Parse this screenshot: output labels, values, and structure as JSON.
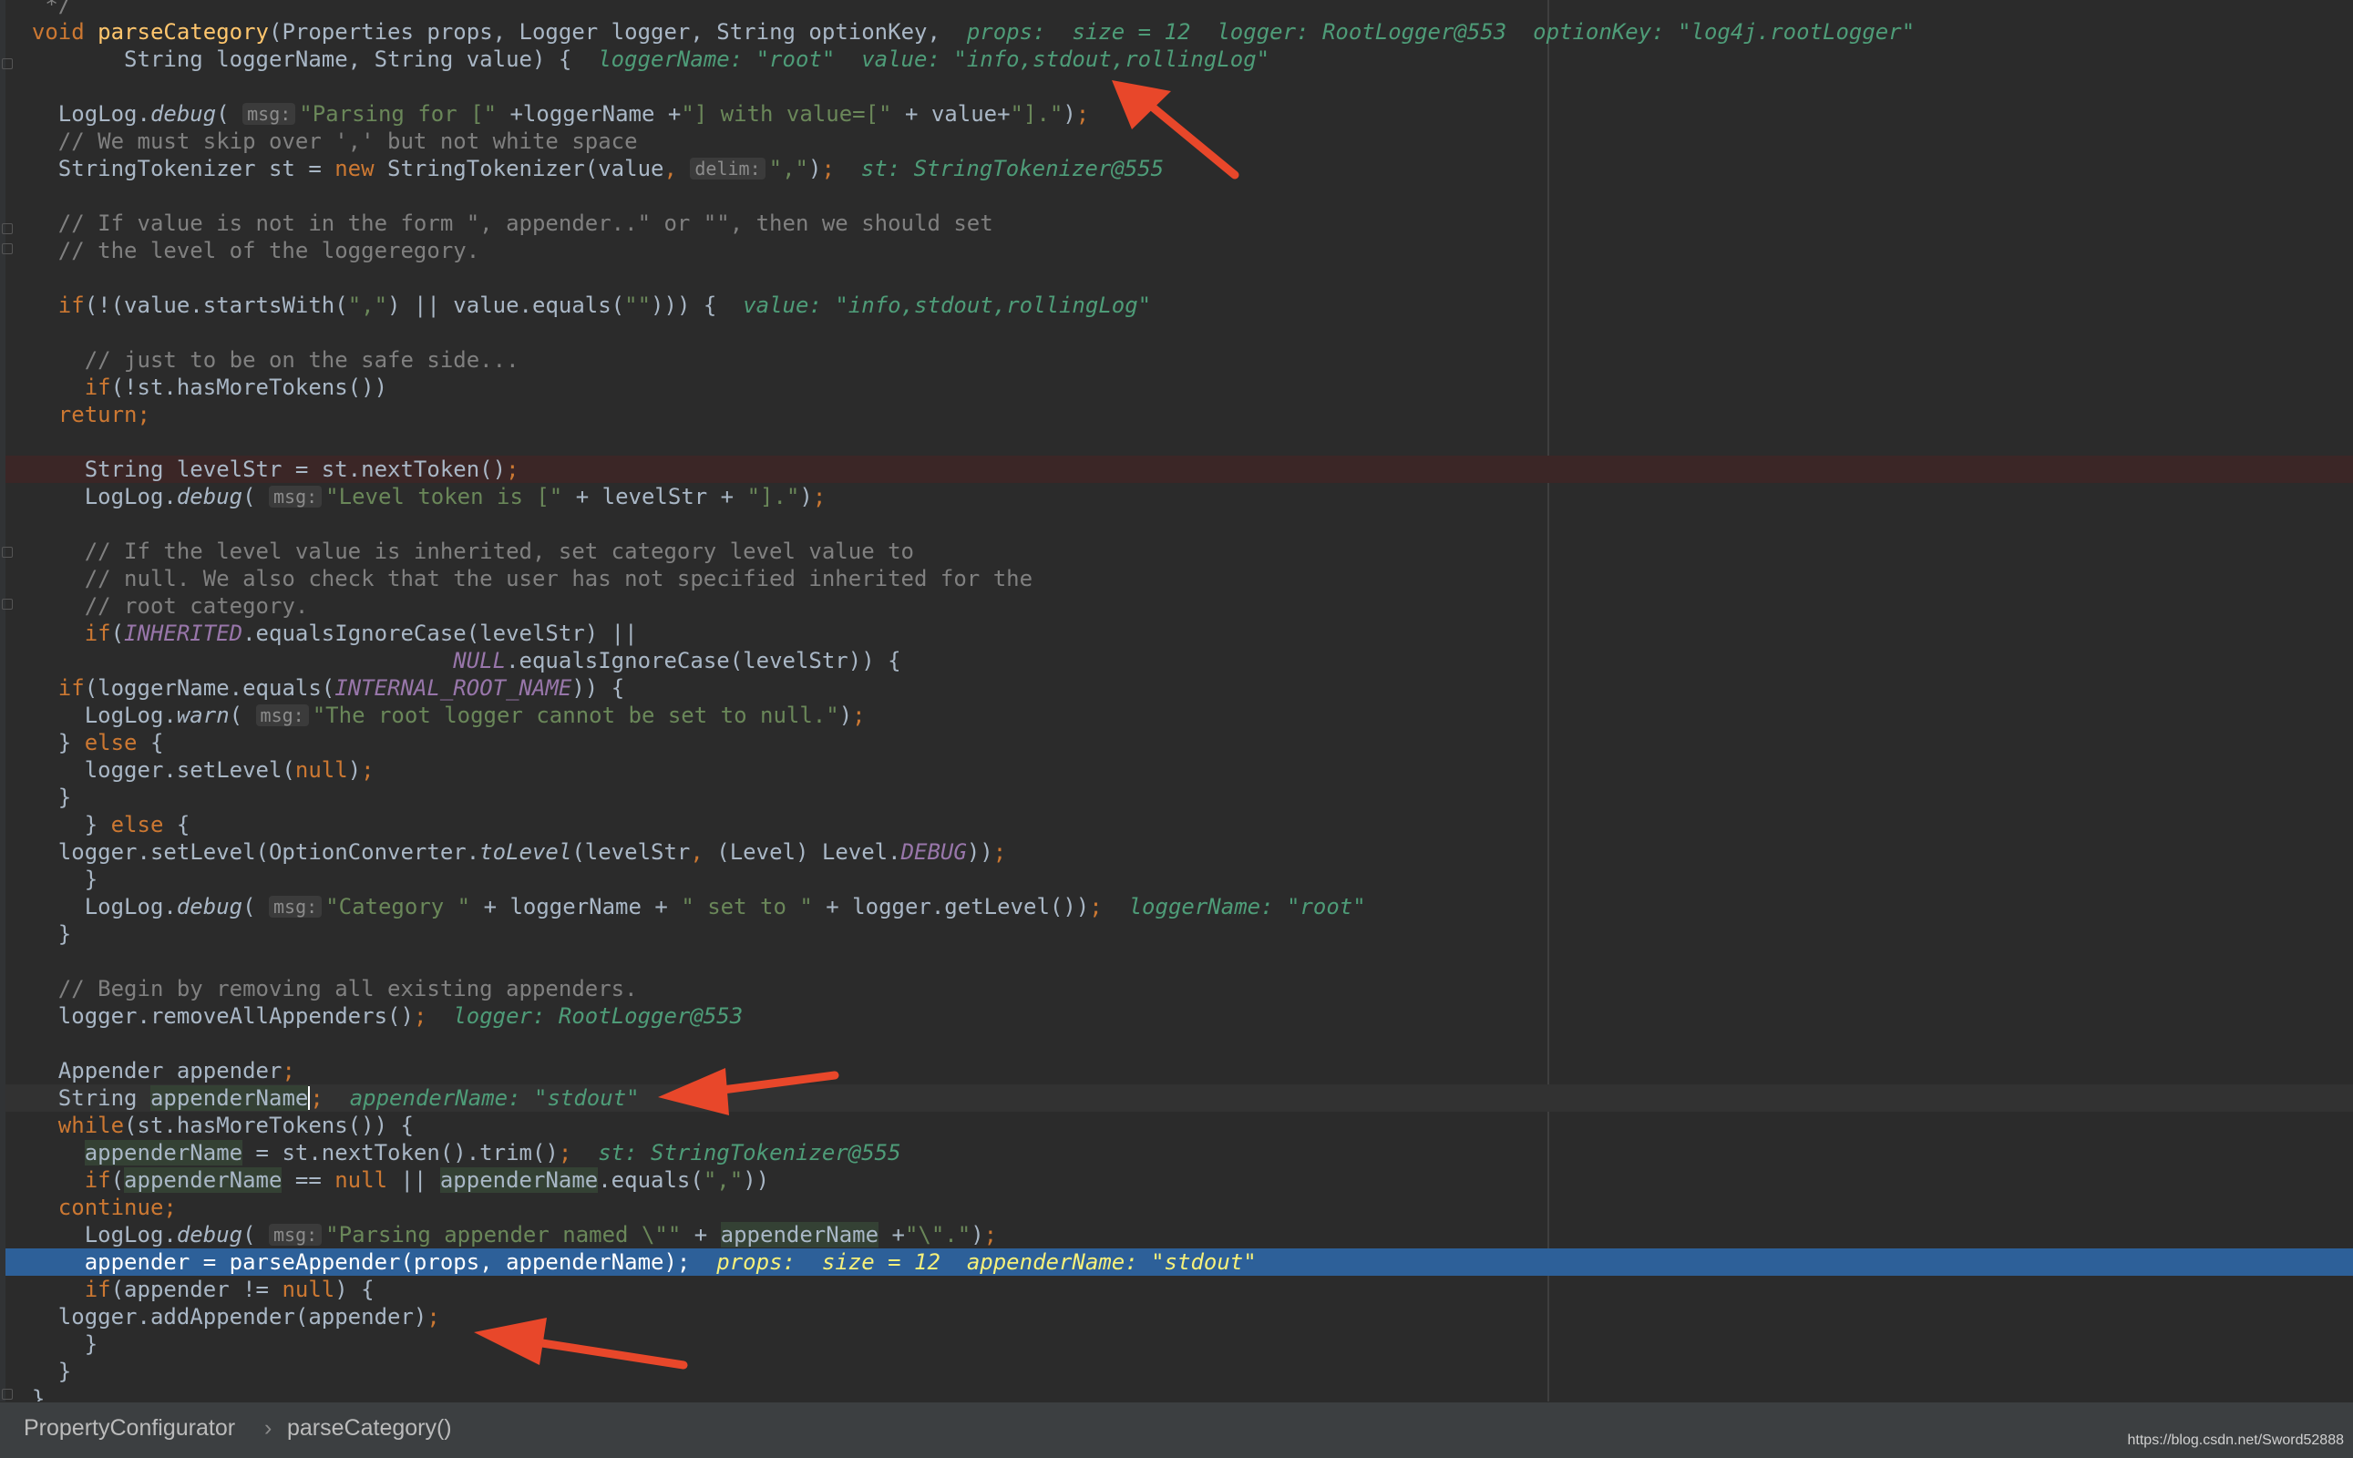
{
  "breadcrumb": {
    "class_name": "PropertyConfigurator",
    "separator": "›",
    "method_name": "parseCategory()"
  },
  "watermark": "https://blog.csdn.net/Sword52888",
  "colors": {
    "background": "#2b2b2b",
    "keyword": "#cc7832",
    "string": "#6a8759",
    "comment": "#808080",
    "method": "#ffc66d",
    "constant": "#9876aa",
    "debug_value": "#4e9c78",
    "execution_line": "#2d6099",
    "annotation_arrow": "#e8472a"
  },
  "code": {
    "lines": [
      {
        "parts": [
          {
            "t": "c",
            "v": "   */"
          }
        ]
      },
      {
        "parts": [
          {
            "t": "k",
            "v": "  void "
          },
          {
            "t": "m",
            "v": "parseCategory"
          },
          {
            "t": "p",
            "v": "(Properties props, Logger logger, String optionKey,  "
          },
          {
            "t": "h",
            "v": "props:  size = 12  logger: RootLogger@553  optionKey: \"log4j.rootLogger\""
          }
        ]
      },
      {
        "parts": [
          {
            "t": "p",
            "v": "         String loggerName, String value) {  "
          },
          {
            "t": "h",
            "v": "loggerName: \"root\"  value: \"info,stdout,rollingLog\""
          }
        ]
      },
      {
        "parts": [
          {
            "t": "p",
            "v": ""
          }
        ]
      },
      {
        "parts": [
          {
            "t": "p",
            "v": "    LogLog."
          },
          {
            "t": "it",
            "v": "debug"
          },
          {
            "t": "p",
            "v": "( "
          },
          {
            "t": "hint",
            "v": "msg:"
          },
          {
            "t": "s",
            "v": "\"Parsing for [\" "
          },
          {
            "t": "p",
            "v": "+loggerName +"
          },
          {
            "t": "s",
            "v": "\"] with value=[\" "
          },
          {
            "t": "p",
            "v": "+ value+"
          },
          {
            "t": "s",
            "v": "\"].\""
          },
          {
            "t": "p",
            "v": ")"
          },
          {
            "t": "k",
            "v": ";"
          }
        ]
      },
      {
        "parts": [
          {
            "t": "c",
            "v": "    // We must skip over ',' but not white space"
          }
        ]
      },
      {
        "parts": [
          {
            "t": "p",
            "v": "    StringTokenizer st = "
          },
          {
            "t": "k",
            "v": "new "
          },
          {
            "t": "p",
            "v": "StringTokenizer(value"
          },
          {
            "t": "k",
            "v": ", "
          },
          {
            "t": "hint",
            "v": "delim:"
          },
          {
            "t": "s",
            "v": "\",\""
          },
          {
            "t": "p",
            "v": ")"
          },
          {
            "t": "k",
            "v": ";  "
          },
          {
            "t": "h",
            "v": "st: StringTokenizer@555"
          }
        ]
      },
      {
        "parts": [
          {
            "t": "p",
            "v": ""
          }
        ]
      },
      {
        "parts": [
          {
            "t": "c",
            "v": "    // If value is not in the form \", appender..\" or \"\", then we should set"
          }
        ]
      },
      {
        "parts": [
          {
            "t": "c",
            "v": "    // the level of the loggeregory."
          }
        ]
      },
      {
        "parts": [
          {
            "t": "p",
            "v": ""
          }
        ]
      },
      {
        "parts": [
          {
            "t": "k",
            "v": "    if"
          },
          {
            "t": "p",
            "v": "(!(value.startsWith("
          },
          {
            "t": "s",
            "v": "\",\""
          },
          {
            "t": "p",
            "v": ") || value.equals("
          },
          {
            "t": "s",
            "v": "\"\""
          },
          {
            "t": "p",
            "v": "))) {  "
          },
          {
            "t": "h",
            "v": "value: \"info,stdout,rollingLog\""
          }
        ]
      },
      {
        "parts": [
          {
            "t": "p",
            "v": ""
          }
        ]
      },
      {
        "parts": [
          {
            "t": "c",
            "v": "      // just to be on the safe side..."
          }
        ]
      },
      {
        "parts": [
          {
            "t": "k",
            "v": "      if"
          },
          {
            "t": "p",
            "v": "(!st.hasMoreTokens())"
          }
        ]
      },
      {
        "parts": [
          {
            "t": "k",
            "v": "    return;"
          }
        ]
      },
      {
        "parts": [
          {
            "t": "p",
            "v": ""
          }
        ]
      },
      {
        "parts": [
          {
            "t": "p",
            "v": "      String levelStr = st.nextToken()"
          },
          {
            "t": "k",
            "v": ";"
          }
        ]
      },
      {
        "parts": [
          {
            "t": "p",
            "v": "      LogLog."
          },
          {
            "t": "it",
            "v": "debug"
          },
          {
            "t": "p",
            "v": "( "
          },
          {
            "t": "hint",
            "v": "msg:"
          },
          {
            "t": "s",
            "v": "\"Level token is [\" "
          },
          {
            "t": "p",
            "v": "+ levelStr + "
          },
          {
            "t": "s",
            "v": "\"].\""
          },
          {
            "t": "p",
            "v": ")"
          },
          {
            "t": "k",
            "v": ";"
          }
        ]
      },
      {
        "parts": [
          {
            "t": "p",
            "v": ""
          }
        ]
      },
      {
        "parts": [
          {
            "t": "c",
            "v": "      // If the level value is inherited, set category level value to"
          }
        ]
      },
      {
        "parts": [
          {
            "t": "c",
            "v": "      // null. We also check that the user has not specified inherited for the"
          }
        ]
      },
      {
        "parts": [
          {
            "t": "c",
            "v": "      // root category."
          }
        ]
      },
      {
        "parts": [
          {
            "t": "k",
            "v": "      if"
          },
          {
            "t": "p",
            "v": "("
          },
          {
            "t": "ic",
            "v": "INHERITED"
          },
          {
            "t": "p",
            "v": ".equalsIgnoreCase(levelStr) ||"
          }
        ]
      },
      {
        "parts": [
          {
            "t": "p",
            "v": "                                  "
          },
          {
            "t": "ic",
            "v": "NULL"
          },
          {
            "t": "p",
            "v": ".equalsIgnoreCase(levelStr)) {"
          }
        ]
      },
      {
        "parts": [
          {
            "t": "k",
            "v": "    if"
          },
          {
            "t": "p",
            "v": "(loggerName.equals("
          },
          {
            "t": "ic",
            "v": "INTERNAL_ROOT_NAME"
          },
          {
            "t": "p",
            "v": ")) {"
          }
        ]
      },
      {
        "parts": [
          {
            "t": "p",
            "v": "      LogLog."
          },
          {
            "t": "it",
            "v": "warn"
          },
          {
            "t": "p",
            "v": "( "
          },
          {
            "t": "hint",
            "v": "msg:"
          },
          {
            "t": "s",
            "v": "\"The root logger cannot be set to null.\""
          },
          {
            "t": "p",
            "v": ")"
          },
          {
            "t": "k",
            "v": ";"
          }
        ]
      },
      {
        "parts": [
          {
            "t": "p",
            "v": "    } "
          },
          {
            "t": "k",
            "v": "else "
          },
          {
            "t": "p",
            "v": "{"
          }
        ]
      },
      {
        "parts": [
          {
            "t": "p",
            "v": "      logger.setLevel("
          },
          {
            "t": "k",
            "v": "null"
          },
          {
            "t": "p",
            "v": ")"
          },
          {
            "t": "k",
            "v": ";"
          }
        ]
      },
      {
        "parts": [
          {
            "t": "p",
            "v": "    }"
          }
        ]
      },
      {
        "parts": [
          {
            "t": "p",
            "v": "      } "
          },
          {
            "t": "k",
            "v": "else "
          },
          {
            "t": "p",
            "v": "{"
          }
        ]
      },
      {
        "parts": [
          {
            "t": "p",
            "v": "    logger.setLevel(OptionConverter."
          },
          {
            "t": "it",
            "v": "toLevel"
          },
          {
            "t": "p",
            "v": "(levelStr"
          },
          {
            "t": "k",
            "v": ", "
          },
          {
            "t": "p",
            "v": "(Level) Level."
          },
          {
            "t": "ic",
            "v": "DEBUG"
          },
          {
            "t": "p",
            "v": "))"
          },
          {
            "t": "k",
            "v": ";"
          }
        ]
      },
      {
        "parts": [
          {
            "t": "p",
            "v": "      }"
          }
        ]
      },
      {
        "parts": [
          {
            "t": "p",
            "v": "      LogLog."
          },
          {
            "t": "it",
            "v": "debug"
          },
          {
            "t": "p",
            "v": "( "
          },
          {
            "t": "hint",
            "v": "msg:"
          },
          {
            "t": "s",
            "v": "\"Category \" "
          },
          {
            "t": "p",
            "v": "+ loggerName + "
          },
          {
            "t": "s",
            "v": "\" set to \" "
          },
          {
            "t": "p",
            "v": "+ logger.getLevel())"
          },
          {
            "t": "k",
            "v": ";  "
          },
          {
            "t": "h",
            "v": "loggerName: \"root\""
          }
        ]
      },
      {
        "parts": [
          {
            "t": "p",
            "v": "    }"
          }
        ]
      },
      {
        "parts": [
          {
            "t": "p",
            "v": ""
          }
        ]
      },
      {
        "parts": [
          {
            "t": "c",
            "v": "    // Begin by removing all existing appenders."
          }
        ]
      },
      {
        "parts": [
          {
            "t": "p",
            "v": "    logger.removeAllAppenders()"
          },
          {
            "t": "k",
            "v": ";  "
          },
          {
            "t": "h",
            "v": "logger: RootLogger@553"
          }
        ]
      },
      {
        "parts": [
          {
            "t": "p",
            "v": ""
          }
        ]
      },
      {
        "parts": [
          {
            "t": "p",
            "v": "    Appender appender"
          },
          {
            "t": "k",
            "v": ";"
          }
        ]
      },
      {
        "parts": [
          {
            "t": "p",
            "v": "    String "
          },
          {
            "t": "vh",
            "v": "appenderName"
          },
          {
            "t": "caret",
            "v": ""
          },
          {
            "t": "k",
            "v": ";  "
          },
          {
            "t": "h",
            "v": "appenderName: \"stdout\""
          }
        ]
      },
      {
        "parts": [
          {
            "t": "k",
            "v": "    while"
          },
          {
            "t": "p",
            "v": "(st.hasMoreTokens()) {"
          }
        ]
      },
      {
        "parts": [
          {
            "t": "p",
            "v": "      "
          },
          {
            "t": "vh",
            "v": "appenderName"
          },
          {
            "t": "p",
            "v": " = st.nextToken().trim()"
          },
          {
            "t": "k",
            "v": ";  "
          },
          {
            "t": "h",
            "v": "st: StringTokenizer@555"
          }
        ]
      },
      {
        "parts": [
          {
            "t": "k",
            "v": "      if"
          },
          {
            "t": "p",
            "v": "("
          },
          {
            "t": "vh",
            "v": "appenderName"
          },
          {
            "t": "p",
            "v": " == "
          },
          {
            "t": "k",
            "v": "null "
          },
          {
            "t": "p",
            "v": "|| "
          },
          {
            "t": "vh",
            "v": "appenderName"
          },
          {
            "t": "p",
            "v": ".equals("
          },
          {
            "t": "s",
            "v": "\",\""
          },
          {
            "t": "p",
            "v": "))"
          }
        ]
      },
      {
        "parts": [
          {
            "t": "k",
            "v": "    continue;"
          }
        ]
      },
      {
        "parts": [
          {
            "t": "p",
            "v": "      LogLog."
          },
          {
            "t": "it",
            "v": "debug"
          },
          {
            "t": "p",
            "v": "( "
          },
          {
            "t": "hint",
            "v": "msg:"
          },
          {
            "t": "s",
            "v": "\"Parsing appender named \\\"\" "
          },
          {
            "t": "p",
            "v": "+ "
          },
          {
            "t": "vh",
            "v": "appenderName"
          },
          {
            "t": "p",
            "v": " +"
          },
          {
            "t": "s",
            "v": "\"\\\".\""
          },
          {
            "t": "p",
            "v": ")"
          },
          {
            "t": "k",
            "v": ";"
          }
        ]
      },
      {
        "parts": [
          {
            "t": "p",
            "v": "      appender = parseAppender(props"
          },
          {
            "t": "k",
            "v": ", "
          },
          {
            "t": "p",
            "v": "appenderName)"
          },
          {
            "t": "k",
            "v": ";  "
          },
          {
            "t": "h",
            "v": "props:  size = 12  appenderName: \"stdout\""
          }
        ]
      },
      {
        "parts": [
          {
            "t": "k",
            "v": "      if"
          },
          {
            "t": "p",
            "v": "(appender != "
          },
          {
            "t": "k",
            "v": "null"
          },
          {
            "t": "p",
            "v": ") {"
          }
        ]
      },
      {
        "parts": [
          {
            "t": "p",
            "v": "    logger.addAppender(appender)"
          },
          {
            "t": "k",
            "v": ";"
          }
        ]
      },
      {
        "parts": [
          {
            "t": "p",
            "v": "      }"
          }
        ]
      },
      {
        "parts": [
          {
            "t": "p",
            "v": "    }"
          }
        ]
      },
      {
        "parts": [
          {
            "t": "p",
            "v": "  }"
          }
        ]
      }
    ]
  }
}
